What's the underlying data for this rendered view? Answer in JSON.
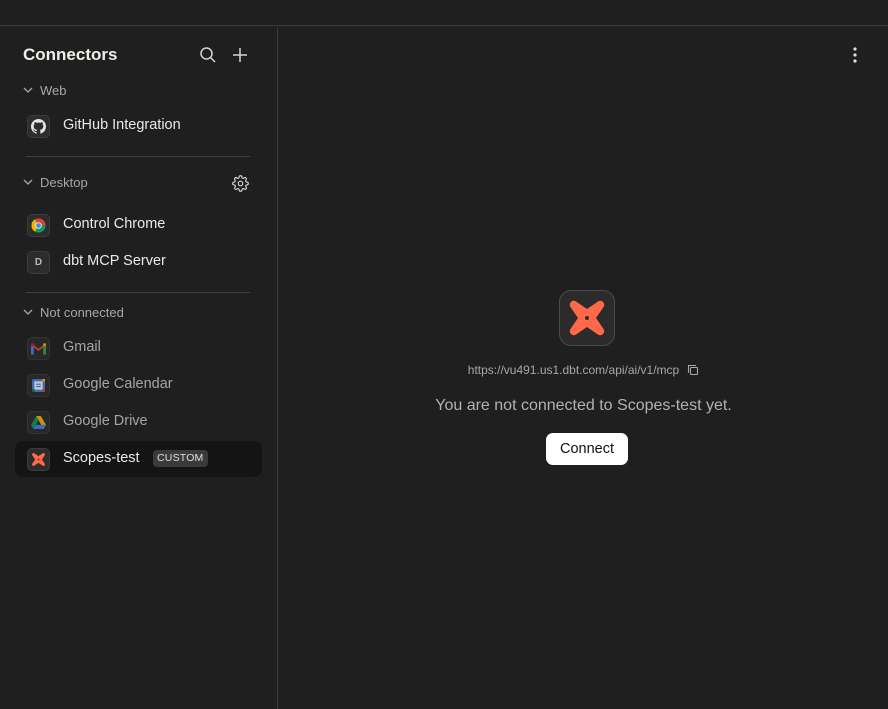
{
  "sidebar": {
    "title": "Connectors",
    "sections": [
      {
        "label": "Web",
        "items": [
          {
            "label": "GitHub Integration",
            "icon": "github-icon"
          }
        ]
      },
      {
        "label": "Desktop",
        "items": [
          {
            "label": "Control Chrome",
            "icon": "chrome-icon"
          },
          {
            "label": "dbt MCP Server",
            "icon": "letter-d-icon",
            "icon_letter": "D"
          }
        ]
      },
      {
        "label": "Not connected",
        "items": [
          {
            "label": "Gmail",
            "icon": "gmail-icon"
          },
          {
            "label": "Google Calendar",
            "icon": "google-calendar-icon"
          },
          {
            "label": "Google Drive",
            "icon": "google-drive-icon"
          },
          {
            "label": "Scopes-test",
            "icon": "dbt-icon",
            "badge": "CUSTOM",
            "selected": true
          }
        ]
      }
    ]
  },
  "main": {
    "url": "https://vu491.us1.dbt.com/api/ai/v1/mcp",
    "status_message": "You are not connected to Scopes-test yet.",
    "connect_label": "Connect"
  },
  "colors": {
    "background": "#1f1f1f",
    "selected_row": "#141414",
    "dbt_orange": "#ff694a",
    "connect_button": "#ffffff"
  }
}
